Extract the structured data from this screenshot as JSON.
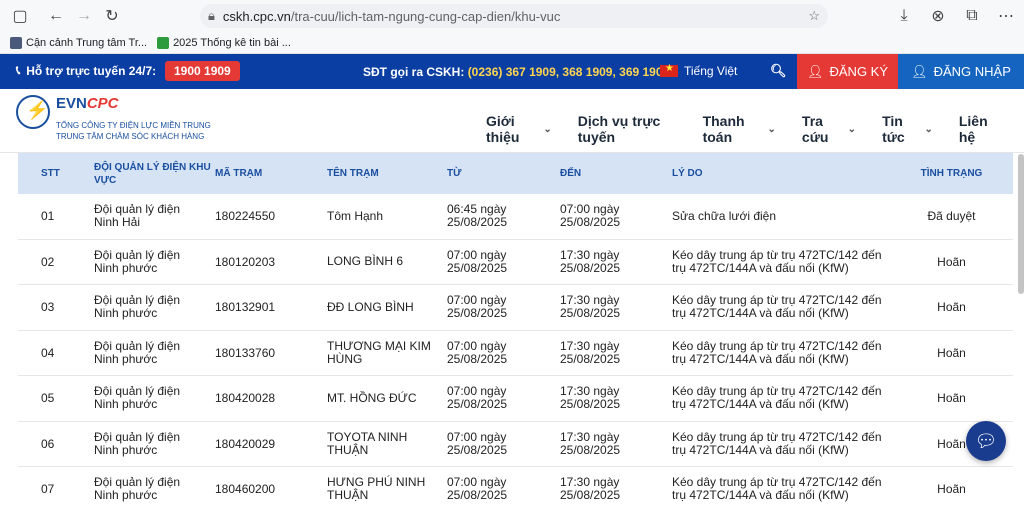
{
  "browser": {
    "url_host": "cskh.cpc.vn",
    "url_path": "/tra-cuu/lich-tam-ngung-cung-cap-dien/khu-vuc",
    "bookmarks": [
      {
        "label": "Cận cảnh Trung tâm Tr..."
      },
      {
        "label": "2025 Thống kê tin bài ..."
      }
    ]
  },
  "topbar": {
    "support_label": "Hỗ trợ trực tuyến 24/7:",
    "hotline": "1900 1909",
    "cskh_label": "SĐT gọi ra CSKH:",
    "cskh_numbers": "(0236) 367 1909, 368 1909, 369 1909",
    "language": "Tiếng Việt",
    "register": "ĐĂNG KÝ",
    "login": "ĐĂNG NHẬP"
  },
  "header": {
    "brand_evn": "EVN",
    "brand_cpc": "CPC",
    "sub1": "TỔNG CÔNG TY ĐIỆN LỰC MIỀN TRUNG",
    "sub2": "TRUNG TÂM CHĂM SÓC KHÁCH HÀNG",
    "nav": [
      {
        "label": "Giới thiệu",
        "dropdown": true
      },
      {
        "label": "Dịch vụ trực tuyến",
        "dropdown": false
      },
      {
        "label": "Thanh toán",
        "dropdown": true
      },
      {
        "label": "Tra cứu",
        "dropdown": true
      },
      {
        "label": "Tin tức",
        "dropdown": true
      },
      {
        "label": "Liên hệ",
        "dropdown": false
      }
    ]
  },
  "table": {
    "headers": {
      "stt": "STT",
      "doi": "ĐỘI QUẢN LÝ ĐIỆN KHU VỰC",
      "ma": "MÃ TRẠM",
      "ten": "TÊN TRẠM",
      "tu": "TỪ",
      "den": "ĐẾN",
      "ly": "LÝ DO",
      "tt": "TÌNH TRẠNG"
    },
    "rows": [
      {
        "stt": "01",
        "doi1": "Đội quản lý điện",
        "doi2": "Ninh Hải",
        "ma": "180224550",
        "ten1": "Tôm Hạnh",
        "ten2": "",
        "tu1": "06:45 ngày",
        "tu2": "25/08/2025",
        "den1": "07:00 ngày",
        "den2": "25/08/2025",
        "ly1": "Sửa chữa lưới điện",
        "ly2": "",
        "tt": "Đã duyệt"
      },
      {
        "stt": "02",
        "doi1": "Đội quản lý điện",
        "doi2": "Ninh phước",
        "ma": "180120203",
        "ten1": "LONG BÌNH 6",
        "ten2": "",
        "tu1": "07:00 ngày",
        "tu2": "25/08/2025",
        "den1": "17:30 ngày",
        "den2": "25/08/2025",
        "ly1": "Kéo dây trung áp từ trụ 472TC/142 đến",
        "ly2": "trụ 472TC/144A và đấu nối (KfW)",
        "tt": "Hoãn"
      },
      {
        "stt": "03",
        "doi1": "Đội quản lý điện",
        "doi2": "Ninh phước",
        "ma": "180132901",
        "ten1": "ĐĐ LONG BÌNH",
        "ten2": "",
        "tu1": "07:00 ngày",
        "tu2": "25/08/2025",
        "den1": "17:30 ngày",
        "den2": "25/08/2025",
        "ly1": "Kéo dây trung áp từ trụ 472TC/142 đến",
        "ly2": "trụ 472TC/144A và đấu nối (KfW)",
        "tt": "Hoãn"
      },
      {
        "stt": "04",
        "doi1": "Đội quản lý điện",
        "doi2": "Ninh phước",
        "ma": "180133760",
        "ten1": "THƯƠNG MẠI KIM",
        "ten2": "HÙNG",
        "tu1": "07:00 ngày",
        "tu2": "25/08/2025",
        "den1": "17:30 ngày",
        "den2": "25/08/2025",
        "ly1": "Kéo dây trung áp từ trụ 472TC/142 đến",
        "ly2": "trụ 472TC/144A và đấu nối (KfW)",
        "tt": "Hoãn"
      },
      {
        "stt": "05",
        "doi1": "Đội quản lý điện",
        "doi2": "Ninh phước",
        "ma": "180420028",
        "ten1": "MT. HỒNG ĐỨC",
        "ten2": "",
        "tu1": "07:00 ngày",
        "tu2": "25/08/2025",
        "den1": "17:30 ngày",
        "den2": "25/08/2025",
        "ly1": "Kéo dây trung áp từ trụ 472TC/142 đến",
        "ly2": "trụ 472TC/144A và đấu nối (KfW)",
        "tt": "Hoãn"
      },
      {
        "stt": "06",
        "doi1": "Đội quản lý điện",
        "doi2": "Ninh phước",
        "ma": "180420029",
        "ten1": "TOYOTA NINH",
        "ten2": "THUẬN",
        "tu1": "07:00 ngày",
        "tu2": "25/08/2025",
        "den1": "17:30 ngày",
        "den2": "25/08/2025",
        "ly1": "Kéo dây trung áp từ trụ 472TC/142 đến",
        "ly2": "trụ 472TC/144A và đấu nối (KfW)",
        "tt": "Hoãn"
      },
      {
        "stt": "07",
        "doi1": "Đội quản lý điện",
        "doi2": "Ninh phước",
        "ma": "180460200",
        "ten1": "HƯNG PHÚ NINH",
        "ten2": "THUẬN",
        "tu1": "07:00 ngày",
        "tu2": "25/08/2025",
        "den1": "17:30 ngày",
        "den2": "25/08/2025",
        "ly1": "Kéo dây trung áp từ trụ 472TC/142 đến",
        "ly2": "trụ 472TC/144A và đấu nối (KfW)",
        "tt": "Hoãn"
      }
    ]
  },
  "colors": {
    "topbar": "#0b3ea3",
    "register": "#e53935",
    "login": "#1565c0",
    "hotline_bg": "#e53935",
    "cskh_numbers": "#ffd54f",
    "table_header_bg": "#d6e3f5"
  }
}
